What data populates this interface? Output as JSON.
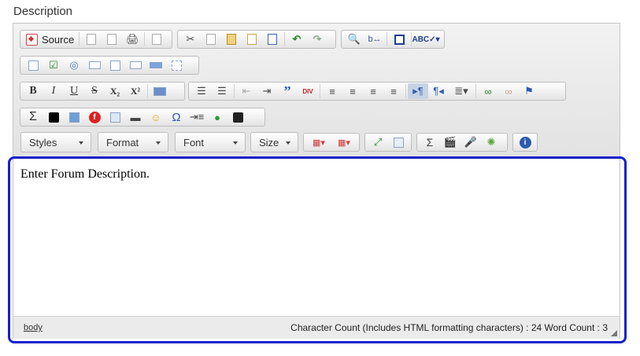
{
  "field": {
    "label": "Description"
  },
  "toolbar": {
    "source_label": "Source",
    "combos": {
      "styles": "Styles",
      "format": "Format",
      "font": "Font",
      "size": "Size"
    },
    "bold": "B",
    "italic": "I",
    "underline": "U",
    "strike": "S",
    "subscript": "X₂",
    "superscript": "X²",
    "blockquote": "”",
    "div": "DIV",
    "sigma": "Σ",
    "omega": "Ω",
    "accent_blue": "#1522cc"
  },
  "editor": {
    "content": "Enter Forum Description."
  },
  "status": {
    "path": "body",
    "count": "Character Count (Includes HTML formatting characters) : 24 Word Count : 3"
  }
}
